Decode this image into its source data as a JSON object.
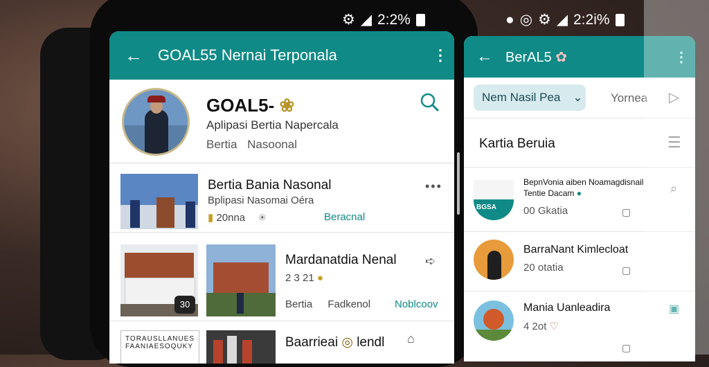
{
  "status_left": {
    "time": "2:2%"
  },
  "status_right": {
    "time": "2:2i%"
  },
  "left_app": {
    "title": "GOAL55 Nernai Terponala",
    "profile": {
      "name": "GOAL5-",
      "subtitle": "Aplipasi Bertia Napercala",
      "meta": [
        "Bertia",
        "Nasoonal"
      ]
    },
    "news": [
      {
        "title": "Bertia Bania Nasonal",
        "subtitle": "Bplipasi Nasomai Oéra",
        "meta": "20nna",
        "tag": "Beracnal"
      },
      {
        "title": "Mardanatdia Nenal",
        "subtitle": "2 3 21",
        "thumb_badge": "30",
        "meta_a": "Bertia",
        "meta_b": "Fadkenol",
        "tag": "Noblcoov"
      },
      {
        "title": "Baarrieai",
        "title_b": "lendl",
        "thumb_text": "TORAUSLLANUES FAANIAESOQUKY"
      }
    ]
  },
  "right_app": {
    "title": "BerAL5",
    "filter": {
      "chip": "Nem Nasil Pea",
      "option": "Yornea"
    },
    "section": "Kartia Beruia",
    "items": [
      {
        "title": "BepnVonia aiben Noamagdisnail",
        "title2": "Tentie Dacam",
        "meta": "00 Gkatia",
        "badge": "BGSA"
      },
      {
        "title": "BarraNant Kimlecloat",
        "meta": "20 otatia"
      },
      {
        "title": "Mania Uanleadira",
        "meta": "4 2ot"
      }
    ]
  },
  "colors": {
    "teal": "#0f8a86",
    "chip_bg": "#d7ebee"
  }
}
